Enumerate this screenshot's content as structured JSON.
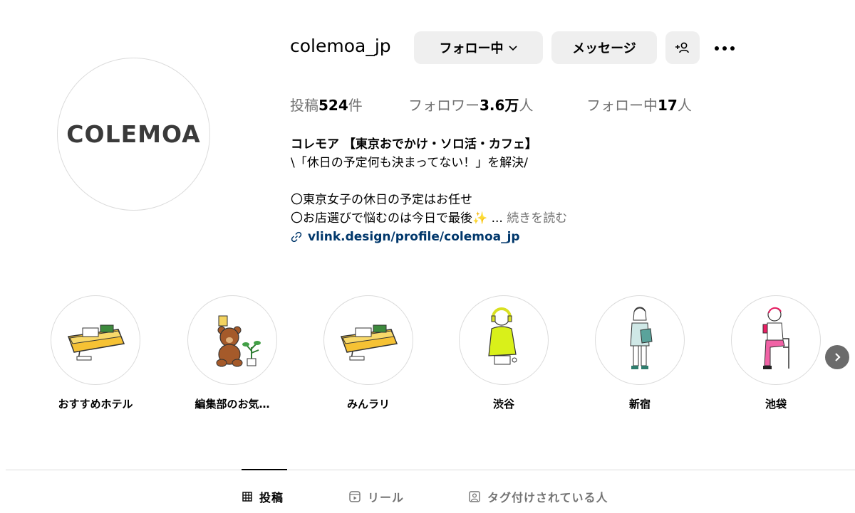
{
  "profile": {
    "logo_text": "COLEMOA",
    "username": "colemoa_jp",
    "follow_label": "フォロー中",
    "message_label": "メッセージ"
  },
  "stats": {
    "posts_label": "投稿",
    "posts_value": "524",
    "posts_unit": "件",
    "followers_label": "フォロワー",
    "followers_value": "3.6万",
    "followers_unit": "人",
    "following_label": "フォロー中",
    "following_value": "17",
    "following_unit": "人"
  },
  "bio": {
    "name": "コレモア 【東京おでかけ・ソロ活・カフェ】",
    "line1": "\\「休日の予定何も決まってない！」を解決/",
    "line2": "〇東京女子の休日の予定はお任せ",
    "line3": "〇お店選びで悩むのは今日で最後✨ ...",
    "more": "続きを読む",
    "link": "vlink.design/profile/colemoa_jp"
  },
  "highlights": [
    {
      "label": "おすすめホテル",
      "icon": "suitcase-illustration"
    },
    {
      "label": "編集部のお気…",
      "icon": "teddy-bear-illustration"
    },
    {
      "label": "みんラリ",
      "icon": "suitcase-illustration"
    },
    {
      "label": "渋谷",
      "icon": "girl-headphones-illustration"
    },
    {
      "label": "新宿",
      "icon": "girl-standing-illustration"
    },
    {
      "label": "池袋",
      "icon": "girl-sitting-illustration"
    }
  ],
  "tabs": [
    {
      "label": "投稿",
      "icon": "grid-icon"
    },
    {
      "label": "リール",
      "icon": "reels-icon"
    },
    {
      "label": "タグ付けされている人",
      "icon": "tagged-icon"
    }
  ]
}
